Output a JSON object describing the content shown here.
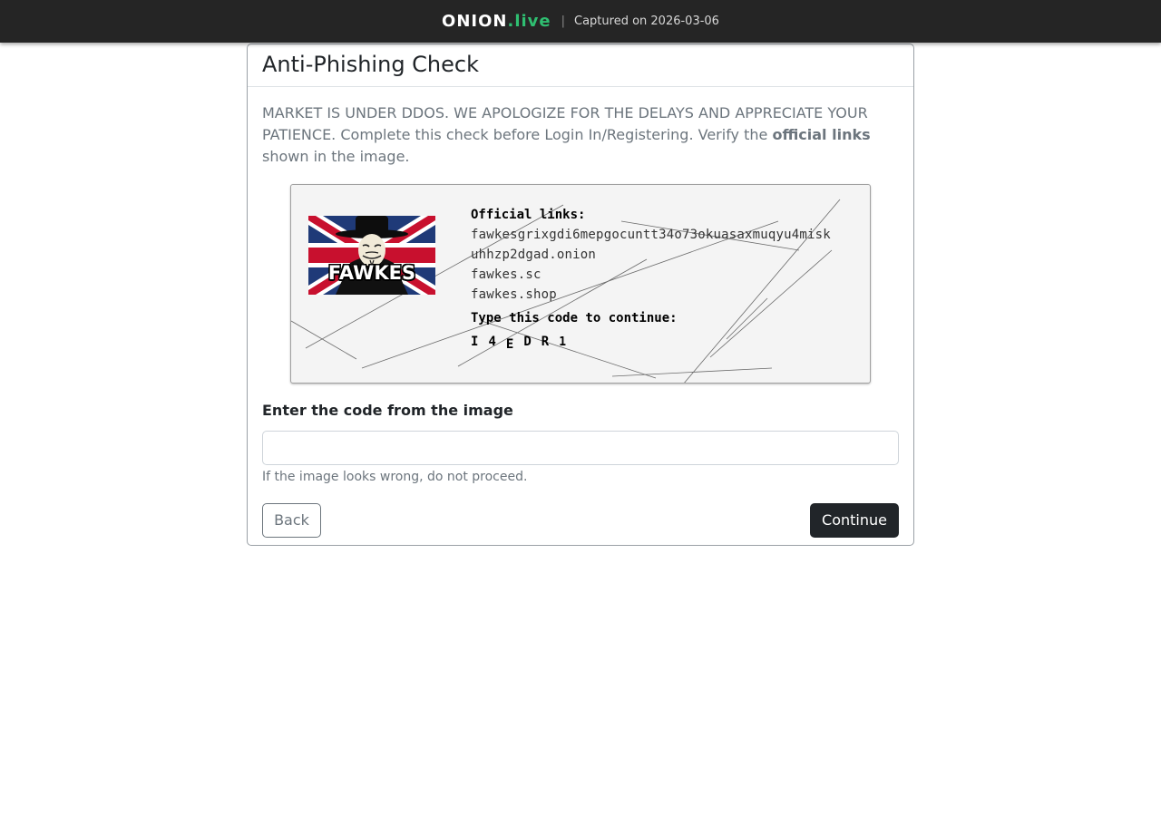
{
  "topbar": {
    "brand_name": "ONION",
    "brand_tld": ".live",
    "separator": "|",
    "captured": "Captured on 2026-03-06"
  },
  "card": {
    "title": "Anti-Phishing Check",
    "notice_text": "MARKET IS UNDER DDOS. WE APOLOGIZE FOR THE DELAYS AND APPRECIATE YOUR PATIENCE. Complete this check before Login In/Registering. Verify the ",
    "notice_bold": "official links",
    "notice_end": " shown in the image."
  },
  "captcha": {
    "logo_text": "FAWKES",
    "links_heading": "Official links:",
    "links": [
      "fawkesgrixgdi6mepgocuntt34o73okuasaxmuqyu4misk",
      "uhhzp2dgad.onion",
      "fawkes.sc",
      "fawkes.shop"
    ],
    "code_prompt": "Type this code to continue:",
    "code_chars": [
      "I",
      "4",
      "E",
      "D",
      "R",
      "1"
    ]
  },
  "form": {
    "label": "Enter the code from the image",
    "input_value": "",
    "input_placeholder": "",
    "help": "If the image looks wrong, do not proceed.",
    "back_label": "Back",
    "continue_label": "Continue"
  },
  "colors": {
    "topbar_bg": "#252525",
    "brand_accent": "#2fbf71",
    "primary_button": "#212529",
    "muted_text": "#6c757d"
  }
}
